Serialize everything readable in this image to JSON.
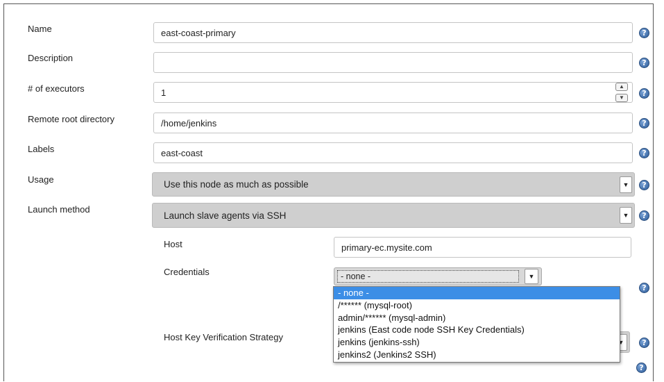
{
  "form": {
    "name": {
      "label": "Name",
      "value": "east-coast-primary"
    },
    "description": {
      "label": "Description",
      "value": ""
    },
    "executors": {
      "label": "# of executors",
      "value": "1"
    },
    "remote_root": {
      "label": "Remote root directory",
      "value": "/home/jenkins"
    },
    "labels": {
      "label": "Labels",
      "value": "east-coast"
    },
    "usage": {
      "label": "Usage",
      "selected": "Use this node as much as possible"
    },
    "launch_method": {
      "label": "Launch method",
      "selected": "Launch slave agents via SSH"
    }
  },
  "ssh": {
    "host": {
      "label": "Host",
      "value": "primary-ec.mysite.com"
    },
    "credentials": {
      "label": "Credentials",
      "selected": "- none -",
      "options": [
        "- none -",
        "/****** (mysql-root)",
        "admin/****** (mysql-admin)",
        "jenkins (East code node SSH Key Credentials)",
        "jenkins (jenkins-ssh)",
        "jenkins2 (Jenkins2 SSH)"
      ]
    },
    "host_key_strategy": {
      "label": "Host Key Verification Strategy"
    }
  },
  "icons": {
    "help": "help-icon",
    "dropdown": "dropdown-arrow-icon",
    "spinner": "number-spinner-icon"
  }
}
